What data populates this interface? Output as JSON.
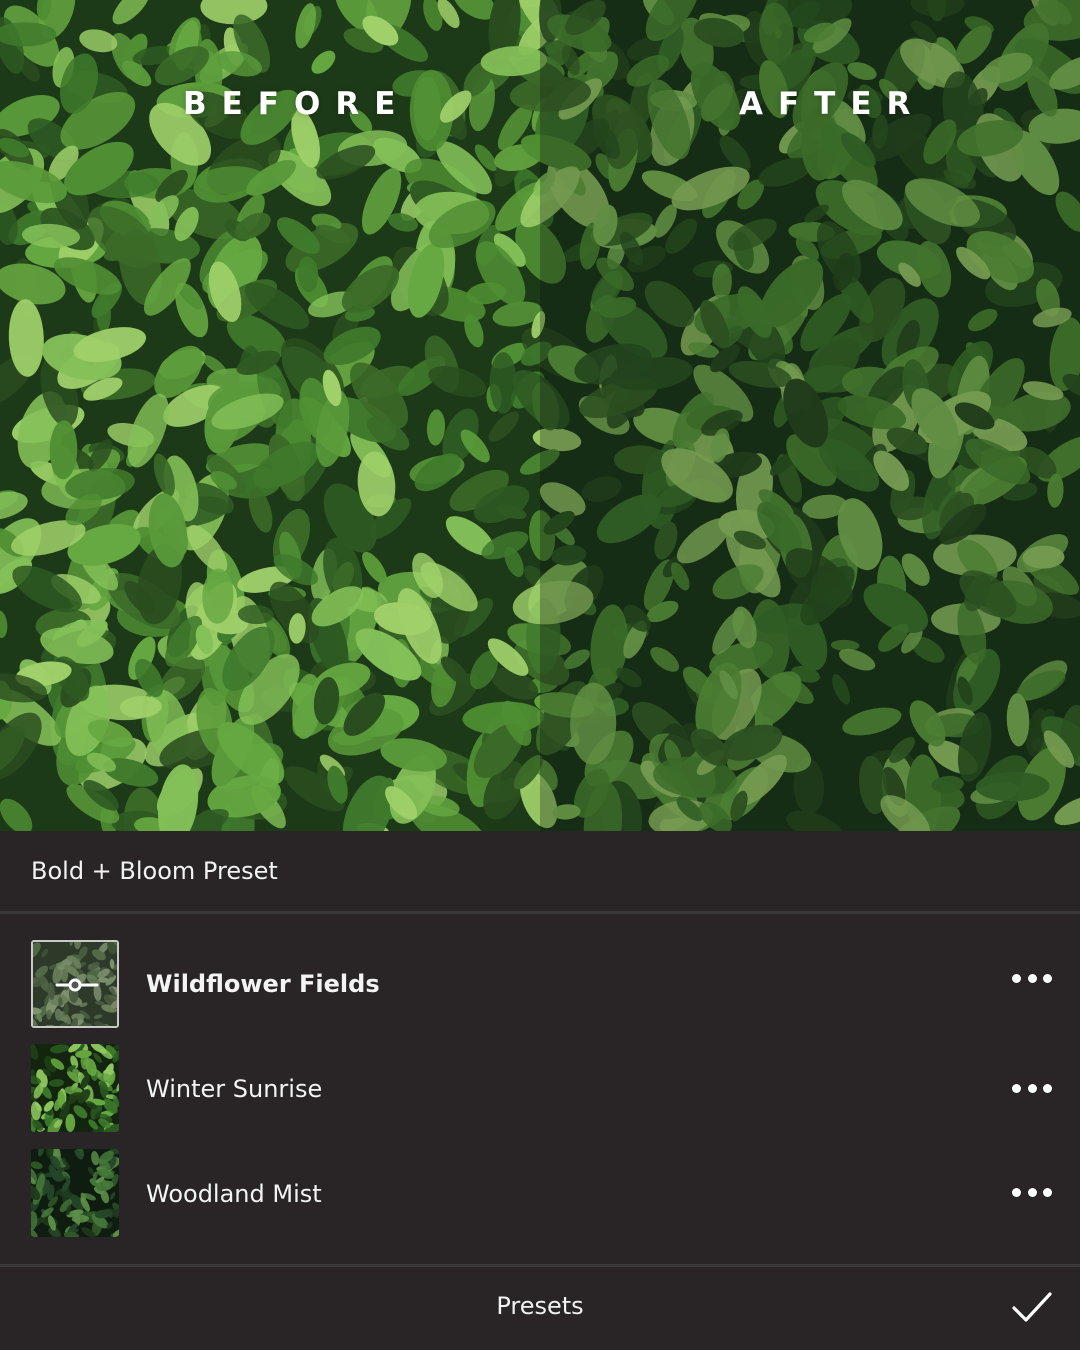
{
  "comparison": {
    "before_label": "BEFORE",
    "after_label": "AFTER"
  },
  "preset_group": {
    "title": "Bold + Bloom Preset"
  },
  "presets": [
    {
      "name": "Wildflower Fields",
      "selected": true,
      "icon": "slider-icon"
    },
    {
      "name": "Winter Sunrise",
      "selected": false
    },
    {
      "name": "Woodland Mist",
      "selected": false
    }
  ],
  "footer": {
    "label": "Presets",
    "confirm_icon": "checkmark-icon"
  },
  "colors": {
    "panel_background": "#292526",
    "divider": "#3b3839",
    "text": "#ffffff"
  }
}
